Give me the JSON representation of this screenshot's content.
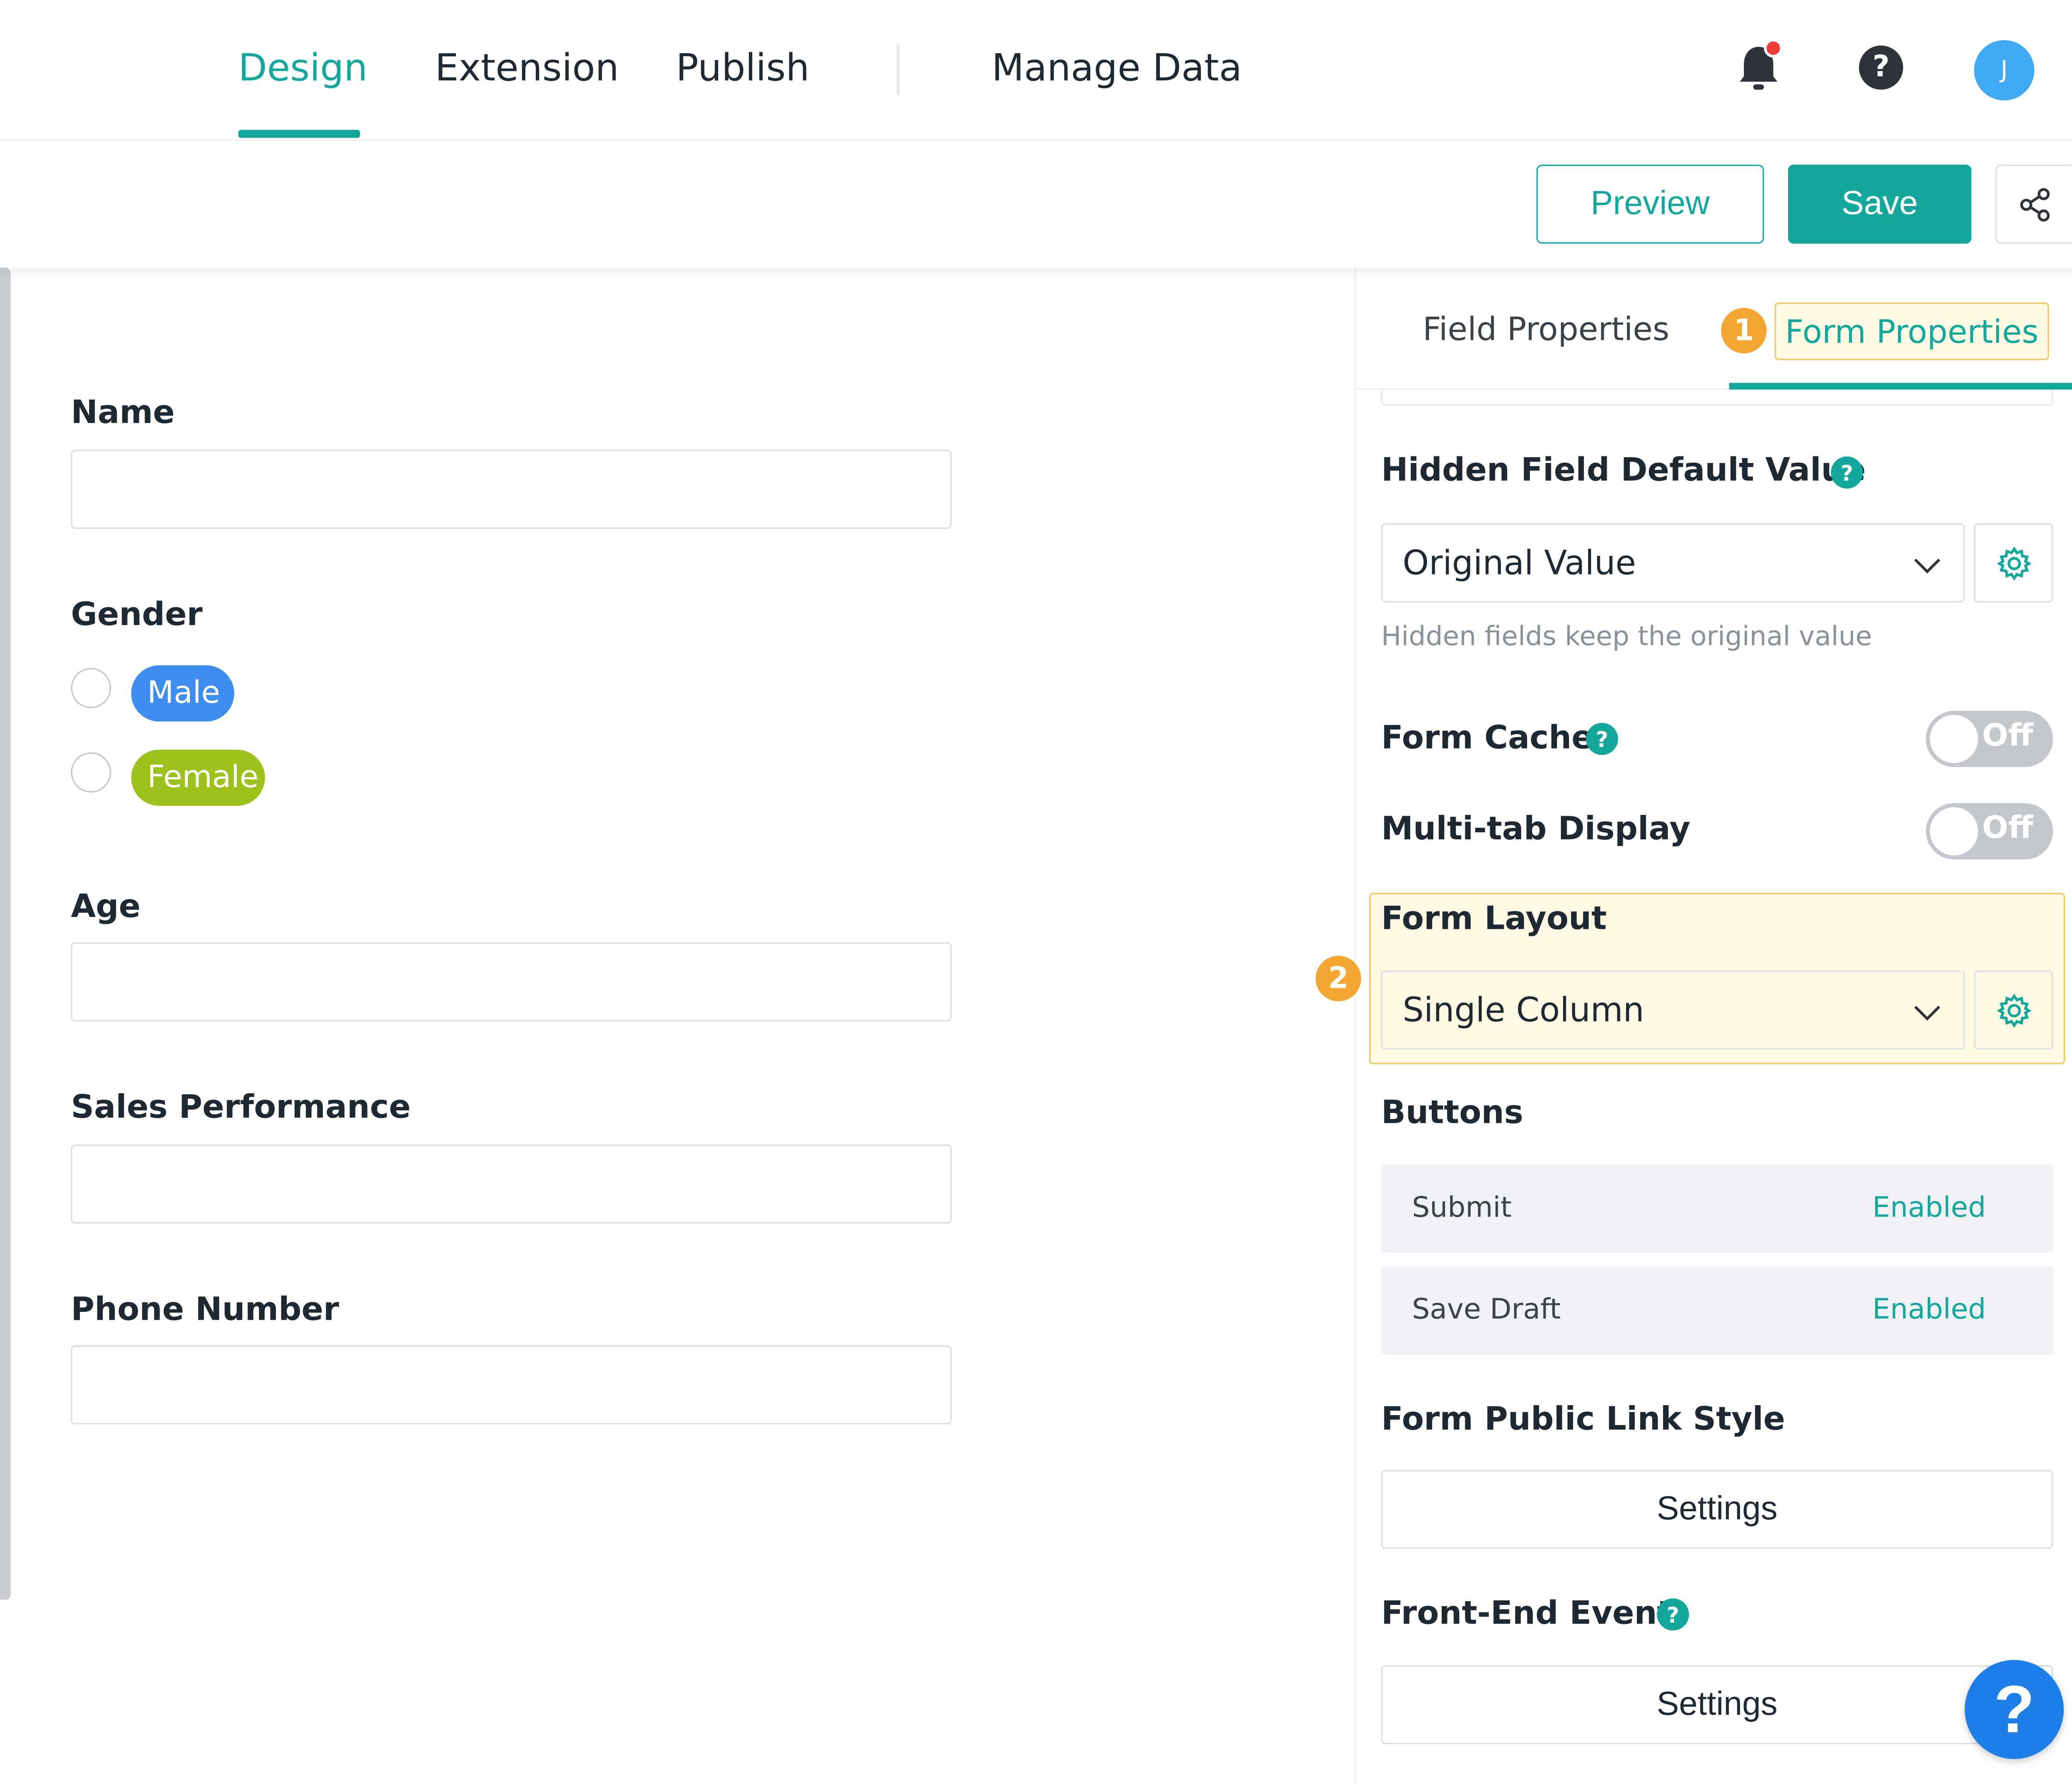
{
  "nav": {
    "tabs": [
      "Design",
      "Extension",
      "Publish",
      "Manage Data"
    ],
    "avatar_initial": "J"
  },
  "toolbar": {
    "preview_label": "Preview",
    "save_label": "Save"
  },
  "form": {
    "fields": {
      "name_label": "Name",
      "gender_label": "Gender",
      "gender_options": [
        "Male",
        "Female"
      ],
      "age_label": "Age",
      "sales_label": "Sales Performance",
      "phone_label": "Phone Number"
    }
  },
  "panel": {
    "tabs": [
      "Field Properties",
      "Form Properties"
    ],
    "badges": [
      "1",
      "2"
    ],
    "hidden_field": {
      "title": "Hidden Field Default Value",
      "value": "Original Value",
      "hint": "Hidden fields keep the original value"
    },
    "form_cache": {
      "title": "Form Cache",
      "state": "Off"
    },
    "multi_tab": {
      "title": "Multi-tab Display",
      "state": "Off"
    },
    "form_layout": {
      "title": "Form Layout",
      "value": "Single Column"
    },
    "buttons": {
      "title": "Buttons",
      "rows": [
        {
          "name": "Submit",
          "status": "Enabled"
        },
        {
          "name": "Save Draft",
          "status": "Enabled"
        }
      ]
    },
    "public_link": {
      "title": "Form Public Link Style",
      "button": "Settings"
    },
    "front_end_event": {
      "title": "Front-End Event",
      "button": "Settings"
    }
  },
  "colors": {
    "accent": "#14a89c",
    "highlight_border": "#f3c55a",
    "highlight_bg": "#fff8e3",
    "badge": "#f3a632",
    "male_pill": "#3d8ef0",
    "female_pill": "#9cc21b",
    "float_help": "#1f7fe8"
  },
  "icons": [
    "bell-icon",
    "help-icon",
    "share-icon",
    "chevron-down-icon",
    "gear-icon",
    "question-icon"
  ]
}
